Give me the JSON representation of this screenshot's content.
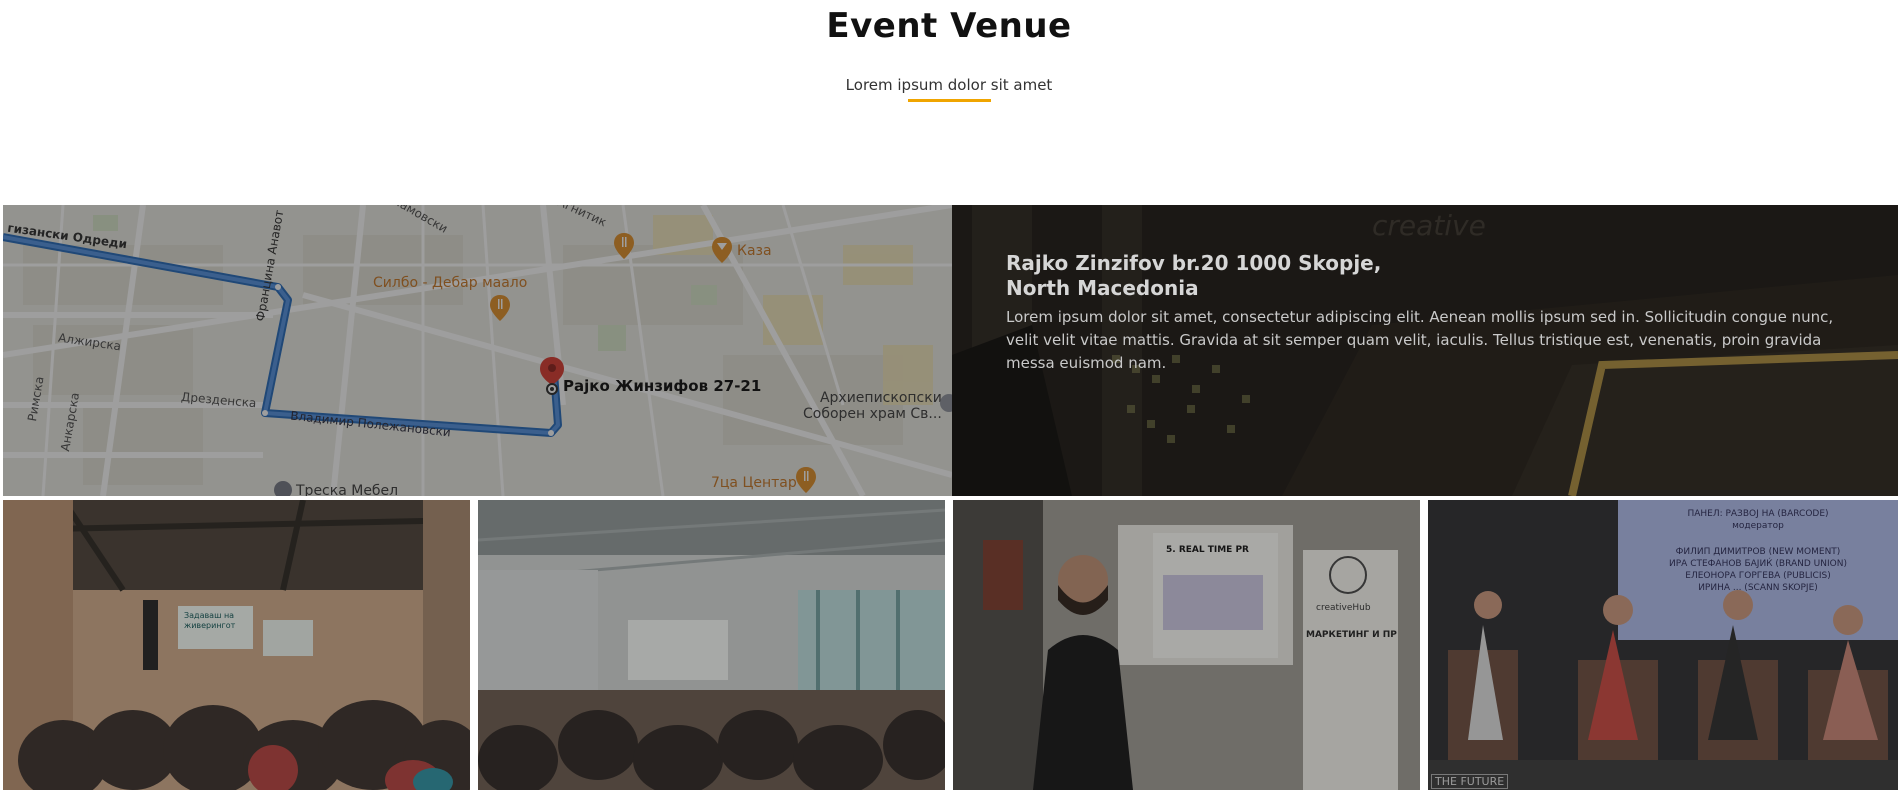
{
  "header": {
    "title": "Event Venue",
    "subtitle": "Lorem ipsum dolor sit amet",
    "accent_color": "#f0a500"
  },
  "map": {
    "labels": {
      "street_top_left": "гизански Одреди",
      "street_diag": "Францина Анавот",
      "street_alzhirska": "Алжирска",
      "street_drezdenska": "Дрезденска",
      "street_rimska": "Римска",
      "street_ankarska": "Анкарска",
      "street_vladimir": "Владимир Полежановски",
      "street_top_mid": "Мамовски",
      "street_top_mid2": "Агнитик",
      "poi_silbo": "Силбо - Дебар маало",
      "poi_kaza": "Каза",
      "destination": "Рајко Жинзифов 27-21",
      "church": "Архиепископски\nСоборен храм Св...",
      "poi_7ca": "7ца Центар",
      "poi_treska": "Треска Мебел"
    },
    "icons": [
      "restaurant-icon",
      "cafe-icon",
      "map-pin-icon",
      "church-icon"
    ]
  },
  "venue": {
    "address_line1": "Rajko Zinzifov br.20 1000 Skopje,",
    "address_line2": "North Macedonia",
    "description": "Lorem ipsum dolor sit amet, consectetur adipiscing elit. Aenean mollis ipsum sed in. Sollicitudin congue nunc, velit velit vitae mattis. Gravida at sit semper quam velit, iaculis. Tellus tristique est, venenatis, proin gravida messa euismod nam."
  },
  "gallery": {
    "photo1_screen": "Задаваш на\nживерингот",
    "photo3_slide": "5. REAL TIME PR",
    "photo3_banner_brand": "creativeHub",
    "photo3_banner_text": "МАРКЕТИНГ И ПР",
    "photo4_screen_title": "ПАНЕЛ: РАЗВОЈ НА (BARCODE)",
    "photo4_screen_sub": "модератор",
    "photo4_screen_lines": [
      "ФИЛИП ДИМИТРОВ (NEW MOMENT)",
      "ИРА СТЕФАНОВ БАЈИЌ (BRAND UNION)",
      "ЕЛЕОНОРА ГОРГЕВА (PUBLICIS)",
      "ИРИНА ... (SCANN SKOPJE)"
    ],
    "photo4_footer": "THE FUTURE"
  }
}
